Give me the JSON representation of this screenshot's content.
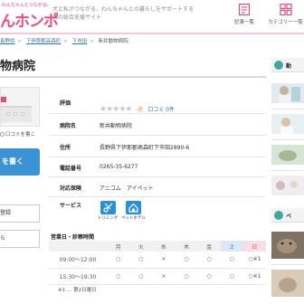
{
  "header": {
    "logo_tag": "わんちゃんとつながる。",
    "logo_text": "んホンポ",
    "tagline": "犬と私がつながる、わんちゃんとの暮らしをサポートする犬の総合支援サイト",
    "icons": [
      {
        "name": "article-list-icon",
        "label": "記事一覧"
      },
      {
        "name": "category-list-icon",
        "label": "カテゴリー一覧"
      }
    ],
    "accent": "#ec4d82"
  },
  "breadcrumb": [
    "長野県",
    "下伊那郡高森町",
    "下市田",
    "新井動物病院"
  ],
  "page_title": "物病院",
  "left": {
    "review_link": "口コミを書こ",
    "cta": "を書く",
    "btn1": "登録",
    "btn2": "ら"
  },
  "info": {
    "rating": {
      "label": "評価",
      "stars": "★★★★★",
      "score": "-点",
      "reviews": "口コミ 0件",
      "stars_filled": 0
    },
    "name": {
      "label": "病院名",
      "value": "新井動物病院"
    },
    "address": {
      "label": "住所",
      "value": "長野県下伊那郡高森町下市田2890-6"
    },
    "phone": {
      "label": "電話番号",
      "value": "0265-35-6277"
    },
    "animals": {
      "label": "対応保険",
      "value": "アニコム　アイペット"
    },
    "services": {
      "label": "サービス",
      "items": [
        {
          "icon": "trimming-icon",
          "label": "トリミング"
        },
        {
          "icon": "pet-hotel-icon",
          "label": "ペットホテル"
        }
      ]
    }
  },
  "hours": {
    "title": "営業日・診察時間",
    "days": [
      "月",
      "火",
      "水",
      "木",
      "金",
      "土",
      "日"
    ],
    "rows": [
      {
        "time": "09:00～12:00",
        "cells": [
          "○",
          "○",
          "×",
          "○",
          "○",
          "○",
          "○※1"
        ]
      },
      {
        "time": "15:30～19:30",
        "cells": [
          "○",
          "○",
          "×",
          "○",
          "○",
          "○",
          "○※1"
        ]
      }
    ],
    "note": "※1 … 第2日曜日"
  },
  "right": {
    "head1": "動",
    "head2": "ペ"
  },
  "colors": {
    "link": "#3a72b8",
    "cta": "#3b93d6",
    "service": "#2a8fd9",
    "saturday": "#dbe8f6",
    "sunday": "#f7dfe5"
  }
}
